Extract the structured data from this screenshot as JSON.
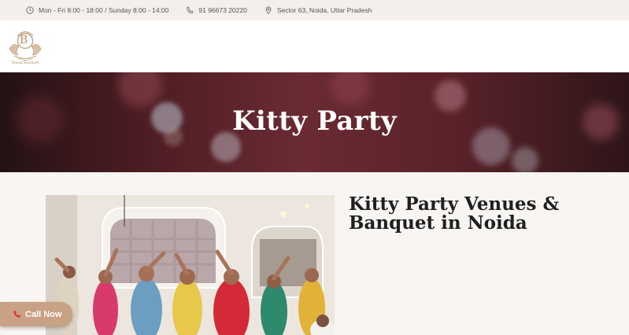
{
  "topbar": {
    "hours": "Mon - Fri 8:00 - 18:00 / Sunday 8:00 - 14:00",
    "phone": "91 96673 20220",
    "address": "Sector 63, Noida, Uttar Pradesh"
  },
  "logo": {
    "initials": "B",
    "tagline": "Diwan Banquet"
  },
  "hero": {
    "title": "Kitty Party"
  },
  "content": {
    "heading": "Kitty Party Venues & Banquet in Noida"
  },
  "call_button": {
    "label": "Call Now"
  },
  "colors": {
    "accent": "#c9a184",
    "hero_bg": "#5a2229",
    "page_bg": "#f9f5f2",
    "topbar_bg": "#f4efec"
  },
  "icons": [
    "clock-icon",
    "phone-icon",
    "location-pin-icon",
    "phone-handset-icon"
  ]
}
